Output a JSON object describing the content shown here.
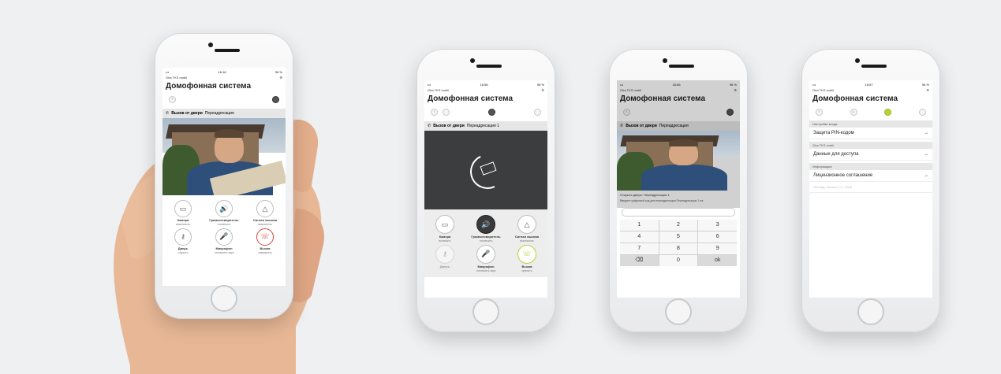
{
  "status": {
    "time1": "16:16",
    "time2": "16:56",
    "time3": "16:56",
    "time4": "16:57",
    "battery": "96 %"
  },
  "app_name": "Gira TKS mobil",
  "title": "Домофонная система",
  "call": {
    "prefix": "Вызов от двери",
    "location": "Переадресация",
    "location_alt": "Переадресация 1"
  },
  "buttons": {
    "camera": {
      "label": "Камера",
      "sub": "выключить",
      "sub_alt": "включить"
    },
    "speaker": {
      "label": "Громкоговоритель",
      "sub": "отключить"
    },
    "bell": {
      "label": "Сигнал вызова",
      "sub": "выключить"
    },
    "door": {
      "label": "Дверь",
      "sub": "открыть"
    },
    "mic": {
      "label": "Микрофон",
      "sub": "отключить звук"
    },
    "call": {
      "label": "Вызов",
      "sub": "завершить",
      "sub_alt": "принять"
    }
  },
  "keypad": {
    "caption": "Открыть дверь: Переадресация 1",
    "prompt": "Введите цифровой код для переадресации Переадресация 1 на:",
    "keys": [
      "1",
      "2",
      "3",
      "4",
      "5",
      "6",
      "7",
      "8",
      "9",
      "⌫",
      "0",
      "ok"
    ]
  },
  "settings": {
    "sections": [
      {
        "header": "Настройки входа",
        "item": "Защита PIN-кодом"
      },
      {
        "header": "Gira TKS mobil",
        "item": "Данные для доступа"
      },
      {
        "header": "Информация",
        "item": "Лицензионное соглашение"
      }
    ],
    "version": "Gira App Version 1.0 - 2015"
  },
  "colors": {
    "accent": "#b6d334",
    "end_call": "#d9453c",
    "background": "#eef0f2"
  }
}
